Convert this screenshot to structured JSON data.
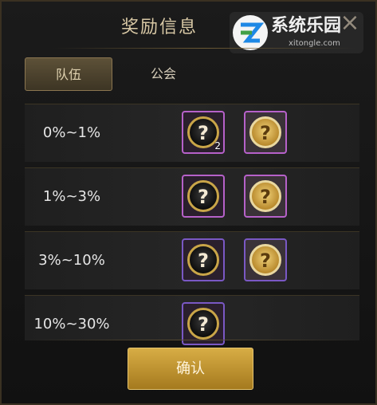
{
  "dialog": {
    "title": "奖励信息",
    "close_label": "×"
  },
  "tabs": [
    {
      "label": "队伍",
      "active": true
    },
    {
      "label": "公会",
      "active": false
    }
  ],
  "rows": [
    {
      "label": "0%~1%",
      "items": [
        {
          "kind": "mystery",
          "count": "2"
        },
        {
          "kind": "mystery-gold"
        }
      ]
    },
    {
      "label": "1%~3%",
      "items": [
        {
          "kind": "mystery"
        },
        {
          "kind": "mystery-gold"
        }
      ]
    },
    {
      "label": "3%~10%",
      "items": [
        {
          "kind": "mystery"
        },
        {
          "kind": "mystery-gold"
        }
      ]
    },
    {
      "label": "10%~30%",
      "items": [
        {
          "kind": "mystery"
        }
      ]
    }
  ],
  "reward_glyph": "?",
  "confirm_label": "确认",
  "watermark": {
    "name": "系统乐园",
    "url": "xitongle.com"
  },
  "colors": {
    "accent_gold": "#d7ad45",
    "slot_purple": "#b661c9",
    "slot_violet": "#7a58c4"
  }
}
